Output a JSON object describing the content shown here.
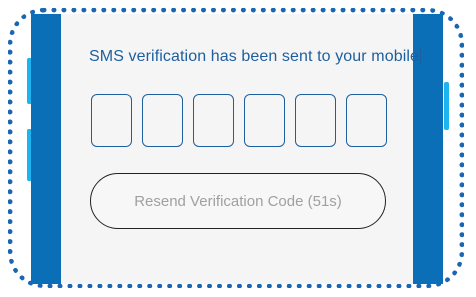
{
  "verification": {
    "title": "SMS verification has been sent to your mobile",
    "code_digits": [
      "",
      "",
      "",
      "",
      "",
      ""
    ],
    "resend_label": "Resend Verification Code (51s)"
  },
  "colors": {
    "accent": "#1d5f9e",
    "bezel": "#0b6fb8",
    "side_button": "#1eb4f0",
    "frame_dots": "#1a66b3"
  }
}
